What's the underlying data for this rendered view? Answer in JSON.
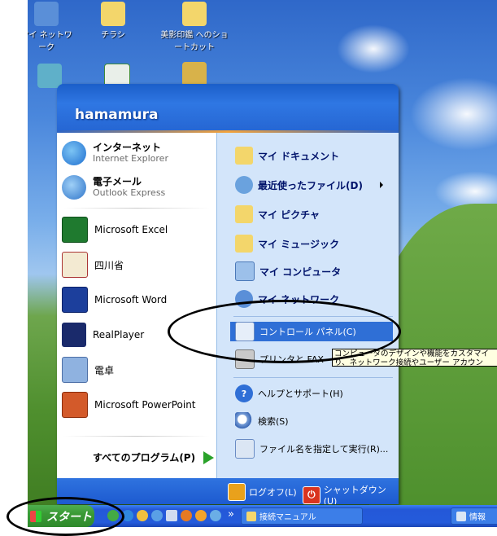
{
  "desktop": {
    "icons": [
      {
        "label": "マイ ネットワーク",
        "icon": "network-icon"
      },
      {
        "label": "チラシ",
        "icon": "folder-icon"
      },
      {
        "label": "美影印鑑 へのショートカット",
        "icon": "folder-shortcut-icon"
      }
    ]
  },
  "start_menu": {
    "user": "hamamura",
    "pinned": [
      {
        "main": "インターネット",
        "sub": "Internet Explorer",
        "icon": "internet-explorer-icon"
      },
      {
        "main": "電子メール",
        "sub": "Outlook Express",
        "icon": "outlook-express-icon"
      }
    ],
    "recent": [
      {
        "label": "Microsoft Excel",
        "icon": "excel-icon"
      },
      {
        "label": "四川省",
        "icon": "mahjong-icon"
      },
      {
        "label": "Microsoft Word",
        "icon": "word-icon"
      },
      {
        "label": "RealPlayer",
        "icon": "realplayer-icon"
      },
      {
        "label": "電卓",
        "icon": "calculator-icon"
      },
      {
        "label": "Microsoft PowerPoint",
        "icon": "powerpoint-icon"
      }
    ],
    "all_programs": "すべてのプログラム(P)",
    "right": {
      "my_documents": "マイ ドキュメント",
      "recent_files": "最近使ったファイル(D)",
      "my_pictures": "マイ ピクチャ",
      "my_music": "マイ ミュージック",
      "my_computer": "マイ コンピュータ",
      "my_network": "マイ ネットワーク",
      "control_panel": "コントロール パネル(C)",
      "printers": "プリンタと FAX",
      "help": "ヘルプとサポート(H)",
      "search": "検索(S)",
      "run": "ファイル名を指定して実行(R)..."
    },
    "logoff": "ログオフ(L)",
    "shutdown": "シャットダウン(U)"
  },
  "tooltip": {
    "line1": "コンピュータのデザインや機能をカスタマイ",
    "line2": "り、ネットワーク接続やユーザー アカウン"
  },
  "taskbar": {
    "start_label": "スタート",
    "overflow": "»",
    "tasks": [
      "接続マニュアル",
      "情報"
    ]
  },
  "colors": {
    "menu_blue": "#2565d2",
    "right_pane": "#d3e5fa",
    "highlight": "#2f6fd6",
    "start_green": "#3a9a35"
  }
}
